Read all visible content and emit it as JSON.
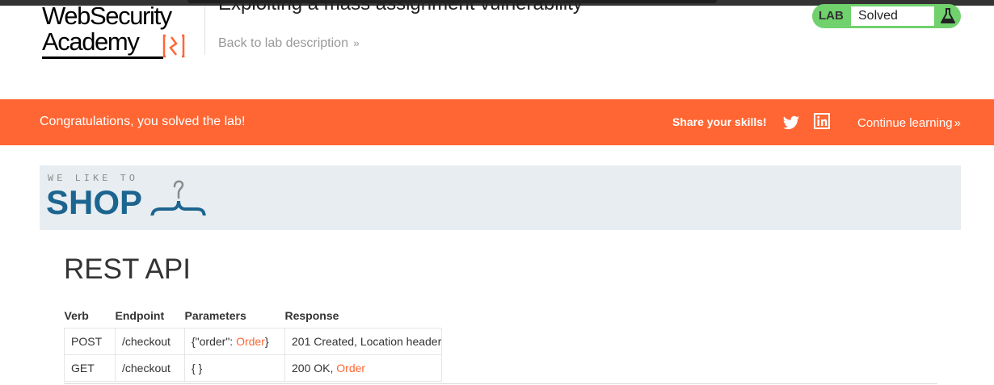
{
  "header": {
    "logo_line1": "WebSecurity",
    "logo_line2": "Academy",
    "lab_title": "Exploiting a mass assignment vulnerability",
    "back_link": "Back to lab description",
    "lab_badge": "LAB",
    "lab_status": "Solved"
  },
  "banner": {
    "message": "Congratulations, you solved the lab!",
    "share": "Share your skills!",
    "continue": "Continue learning"
  },
  "shop": {
    "tagline": "WE LIKE TO",
    "brand": "SHOP"
  },
  "content": {
    "title": "REST API",
    "table": {
      "headers": [
        "Verb",
        "Endpoint",
        "Parameters",
        "Response"
      ],
      "rows": [
        {
          "verb": "POST",
          "endpoint": "/checkout",
          "params_prefix": "{\"order\": ",
          "params_link": "Order",
          "params_suffix": "}",
          "response_text": "201 Created, Location header",
          "response_link": ""
        },
        {
          "verb": "GET",
          "endpoint": "/checkout",
          "params_prefix": "{ }",
          "params_link": "",
          "params_suffix": "",
          "response_text": "200 OK, ",
          "response_link": "Order"
        }
      ]
    }
  },
  "colors": {
    "accent_orange": "#ff6633",
    "lab_green": "#70d16d",
    "shop_blue": "#1c6590",
    "hero_bg": "#e7edf0"
  },
  "icons": [
    "logo-mark-icon",
    "chevrons-right-icon",
    "flask-icon",
    "twitter-icon",
    "linkedin-icon",
    "hanger-icon"
  ]
}
